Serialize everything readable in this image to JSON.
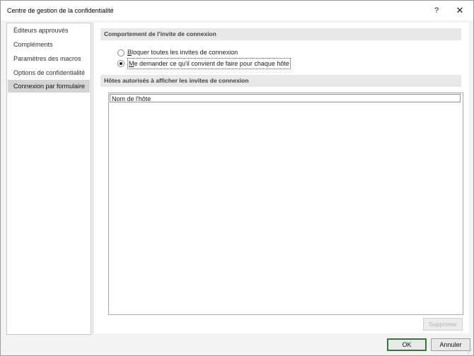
{
  "window": {
    "title": "Centre de gestion de la confidentialité",
    "help": "?",
    "close": "✕"
  },
  "sidebar": {
    "items": [
      {
        "label": "Éditeurs approuvés"
      },
      {
        "label": "Compléments"
      },
      {
        "label": "Paramètres des macros"
      },
      {
        "label": "Options de confidentialité"
      },
      {
        "label": "Connexion par formulaire",
        "selected": true
      }
    ]
  },
  "main": {
    "section1": {
      "heading": "Comportement de l'invite de connexion"
    },
    "options": [
      {
        "label_pre": "",
        "mnemonic": "B",
        "label_post": "loquer toutes les invites de connexion",
        "checked": false
      },
      {
        "label_pre": "",
        "mnemonic": "M",
        "label_post": "e demander ce qu'il convient de faire pour chaque hôte",
        "checked": true
      }
    ],
    "section2": {
      "heading": "Hôtes autorisés à afficher les invites de connexion"
    },
    "hosts_list": {
      "column_header": "Nom de l'hôte",
      "rows": []
    },
    "remove_button": "Supprimer"
  },
  "footer": {
    "ok": "OK",
    "cancel": "Annuler"
  }
}
